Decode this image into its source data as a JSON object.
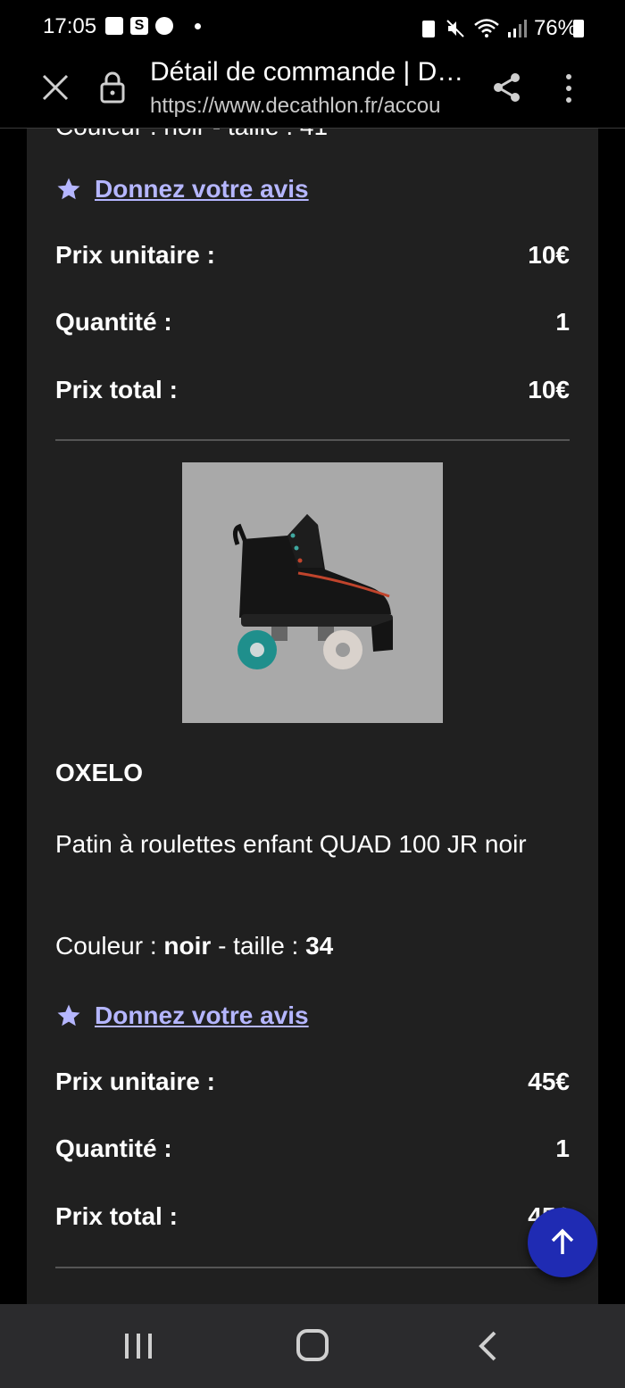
{
  "status_bar": {
    "time": "17:05",
    "battery": "76%",
    "icons": [
      "image-icon",
      "s-app-icon",
      "face-icon",
      "dot-icon",
      "battery-saver-icon",
      "mute-icon",
      "wifi-icon",
      "signal-icon",
      "battery-icon"
    ]
  },
  "toolbar": {
    "title": "Détail de commande | D…",
    "url": "https://www.decathlon.fr/accou"
  },
  "order": {
    "prev_item": {
      "attributes_cutoff": "Couleur : noir - taille : 41",
      "review_link": "Donnez votre avis",
      "unit_price_label": "Prix unitaire :",
      "unit_price": "10€",
      "quantity_label": "Quantité :",
      "quantity": "1",
      "total_label": "Prix total :",
      "total": "10€"
    },
    "item": {
      "brand": "OXELO",
      "name": "Patin à roulettes enfant QUAD 100 JR noir",
      "color_label": "Couleur : ",
      "color": "noir",
      "size_label": " - taille : ",
      "size": "34",
      "review_link": "Donnez votre avis",
      "unit_price_label": "Prix unitaire :",
      "unit_price": "45€",
      "quantity_label": "Quantité :",
      "quantity": "1",
      "total_label": "Prix total :",
      "total": "45€"
    }
  },
  "colors": {
    "link": "#b5b6ff",
    "fab": "#1f2bb3",
    "card_bg": "#202020"
  }
}
